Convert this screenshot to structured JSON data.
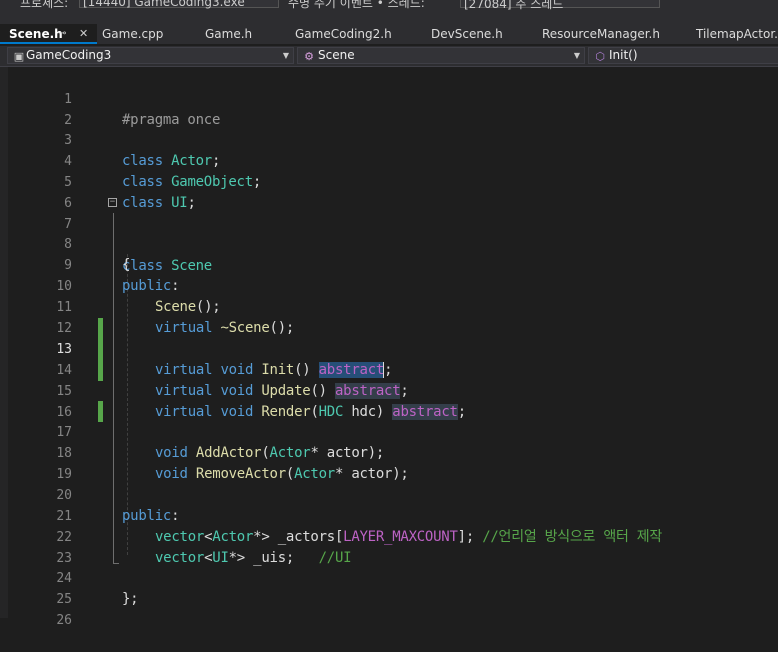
{
  "toolbar": {
    "process_label": "프로세스:",
    "process_value": "[14440] GameCoding3.exe",
    "lifecycle_label": "수명 주기 이벤트 • 스레드:",
    "thread_value": "[27084] 주 스레드"
  },
  "tabs": [
    {
      "label": "Scene.h",
      "active": true
    },
    {
      "label": "Game.cpp"
    },
    {
      "label": "Game.h"
    },
    {
      "label": "GameCoding2.h"
    },
    {
      "label": "DevScene.h"
    },
    {
      "label": "ResourceManager.h"
    },
    {
      "label": "TilemapActor.h"
    }
  ],
  "tab_icons": {
    "pin": "pin-icon",
    "close": "close-icon"
  },
  "navbar": {
    "project": "GameCoding3",
    "scope": "Scene",
    "member": "Init()"
  },
  "editor": {
    "line_numbers": [
      "1",
      "2",
      "3",
      "4",
      "5",
      "6",
      "7",
      "8",
      "9",
      "10",
      "11",
      "12",
      "13",
      "14",
      "15",
      "16",
      "17",
      "18",
      "19",
      "20",
      "21",
      "22",
      "23",
      "24",
      "25",
      "26"
    ],
    "lines": {
      "l1": {
        "pp": "#pragma once"
      },
      "l3": {
        "kw": "class",
        "ty": "Actor",
        "punct": ";"
      },
      "l4": {
        "kw": "class",
        "ty": "GameObject",
        "punct": ";"
      },
      "l5": {
        "kw": "class",
        "ty": "UI",
        "punct": ";"
      },
      "l7": {
        "kw": "class",
        "ty": "Scene"
      },
      "l8": {
        "text": "{"
      },
      "l9": {
        "kw": "public",
        "punct": ":"
      },
      "l10": {
        "fn": "Scene",
        "rest": "();"
      },
      "l11": {
        "kw": "virtual",
        "fn": "~Scene",
        "rest": "();"
      },
      "l13": {
        "kw1": "virtual",
        "kw2": "void",
        "fn": "Init",
        "rest": "()",
        "macro": "abstract",
        "tail": ";"
      },
      "l14": {
        "kw1": "virtual",
        "kw2": "void",
        "fn": "Update",
        "rest": "()",
        "macro": "abstract",
        "tail": ";"
      },
      "l15": {
        "kw1": "virtual",
        "kw2": "void",
        "fn": "Render",
        "p1": "(",
        "ty": "HDC",
        "p2": " hdc)",
        "macro": "abstract",
        "tail": ";"
      },
      "l17": {
        "kw": "void",
        "fn": "AddActor",
        "p1": "(",
        "ty": "Actor",
        "p2": "* actor);"
      },
      "l18": {
        "kw": "void",
        "fn": "RemoveActor",
        "p1": "(",
        "ty": "Actor",
        "p2": "* actor);"
      },
      "l20": {
        "kw": "public",
        "punct": ":"
      },
      "l21": {
        "ty1": "vector",
        "p1": "<",
        "ty2": "Actor",
        "p2": "*> _actors[",
        "mac": "LAYER_MAXCOUNT",
        "p3": "]; ",
        "cm": "//언리얼 방식으로 액터 제작"
      },
      "l22": {
        "ty1": "vector",
        "p1": "<",
        "ty2": "UI",
        "p2": "*> _uis;   ",
        "cm": "//UI"
      },
      "l24": {
        "text": "};"
      }
    }
  },
  "colors": {
    "background": "#1e1e1e",
    "keyword": "#569cd6",
    "type": "#4ec9b0",
    "function": "#dcdcaa",
    "macro": "#bd63c5",
    "comment": "#57a64a",
    "selection": "#264f78",
    "change_marker": "#57a64a",
    "accent": "#007acc"
  }
}
